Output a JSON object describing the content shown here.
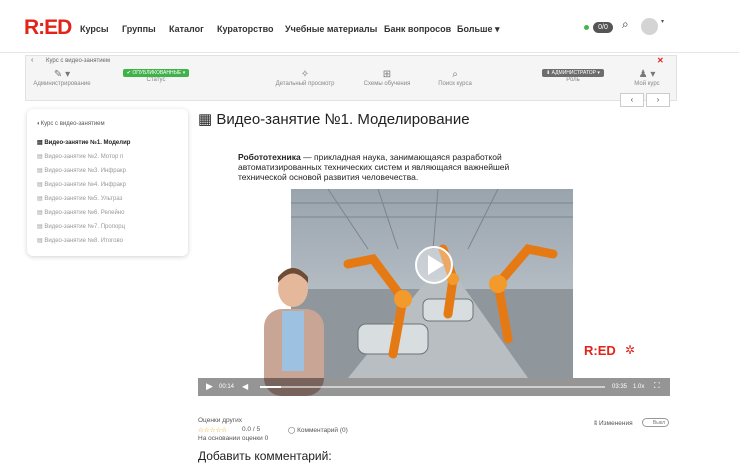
{
  "header": {
    "logo": "R:ED",
    "nav": [
      "Курсы",
      "Группы",
      "Каталог",
      "Кураторство",
      "Учебные материалы",
      "Банк вопросов",
      "Больше ▾"
    ],
    "counter": "0/0"
  },
  "course_bar": {
    "back_label": "Курс с видео-занятием",
    "tools": [
      {
        "icon": "wrench-icon",
        "glyph": "✎",
        "label": "Администрирование"
      },
      {
        "icon": "check-icon",
        "glyph": "✔",
        "label": "Статус",
        "badge": "✔ ОПУБЛИКОВАННЫЕ ▾"
      },
      {
        "icon": "lightbulb-icon",
        "glyph": "✧",
        "label": "Детальный просмотр"
      },
      {
        "icon": "sitemap-icon",
        "glyph": "⊞",
        "label": "Схемы обучения"
      },
      {
        "icon": "search-icon",
        "glyph": "⌕",
        "label": "Поиск курса"
      },
      {
        "icon": "role-icon",
        "glyph": "",
        "label": "Роль",
        "badge": "⬇ АДМИНИСТРАТОР ▾"
      },
      {
        "icon": "user-icon",
        "glyph": "♟",
        "label": "Мой курс"
      }
    ],
    "prev": "‹",
    "next": "›"
  },
  "sidebar": {
    "title": "Курс с видео-занятием",
    "items": [
      "Видео-занятие №1. Моделир",
      "Видео-занятие №2. Мотор п",
      "Видео-занятие №3. Инфракр",
      "Видео-занятие №4. Инфракр",
      "Видео-занятие №5. Ультраз",
      "Видео-занятие №6. Релейно",
      "Видео-занятие №7. Пропорц",
      "Видео-занятие №8. Итогово"
    ]
  },
  "main": {
    "title": "Видео-занятие №1. Моделирование",
    "para_bold": "Робототехника",
    "para_text": " — прикладная наука, занимающаяся разработкой автоматизированных технических систем и являющаяся важнейшей технической основой развития человечества.",
    "video": {
      "watermark": "R:ED",
      "time_current": "00:14",
      "time_total": "03:35",
      "quality": "1.0x",
      "progress": 0.06
    }
  },
  "rating": {
    "label": "Оценки других",
    "stars": "☆☆☆☆☆",
    "score": "0.0 / 5",
    "based": "На основании оценки 0",
    "comments": "Комментарий (0)",
    "changes": "Изменения",
    "toggle": "Выкл"
  },
  "add_comment": "Добавить комментарий:"
}
